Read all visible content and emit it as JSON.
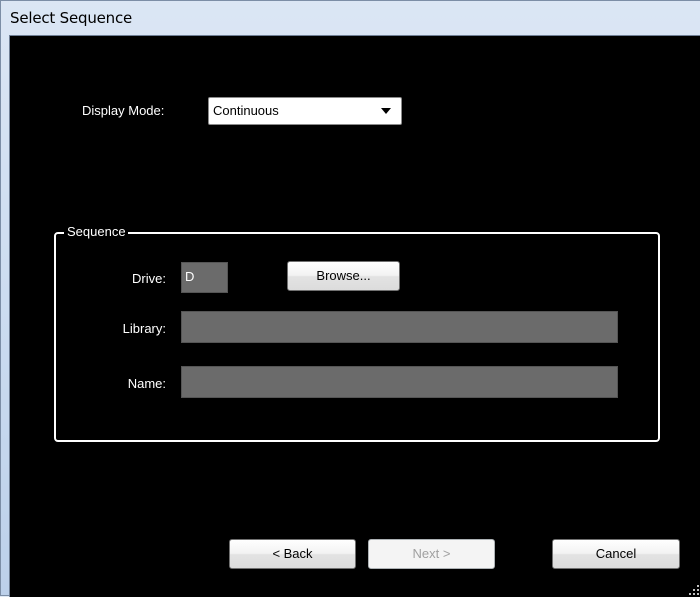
{
  "window": {
    "title": "Select Sequence"
  },
  "display_mode": {
    "label": "Display Mode:",
    "value": "Continuous"
  },
  "sequence_group": {
    "title": "Sequence",
    "drive_label": "Drive:",
    "drive_value": "D",
    "browse_label": "Browse...",
    "library_label": "Library:",
    "library_value": "",
    "name_label": "Name:",
    "name_value": ""
  },
  "buttons": {
    "back": "< Back",
    "next": "Next >",
    "cancel": "Cancel"
  },
  "colors": {
    "background": "#000000",
    "field": "#6b6b6b",
    "text": "#ffffff"
  }
}
